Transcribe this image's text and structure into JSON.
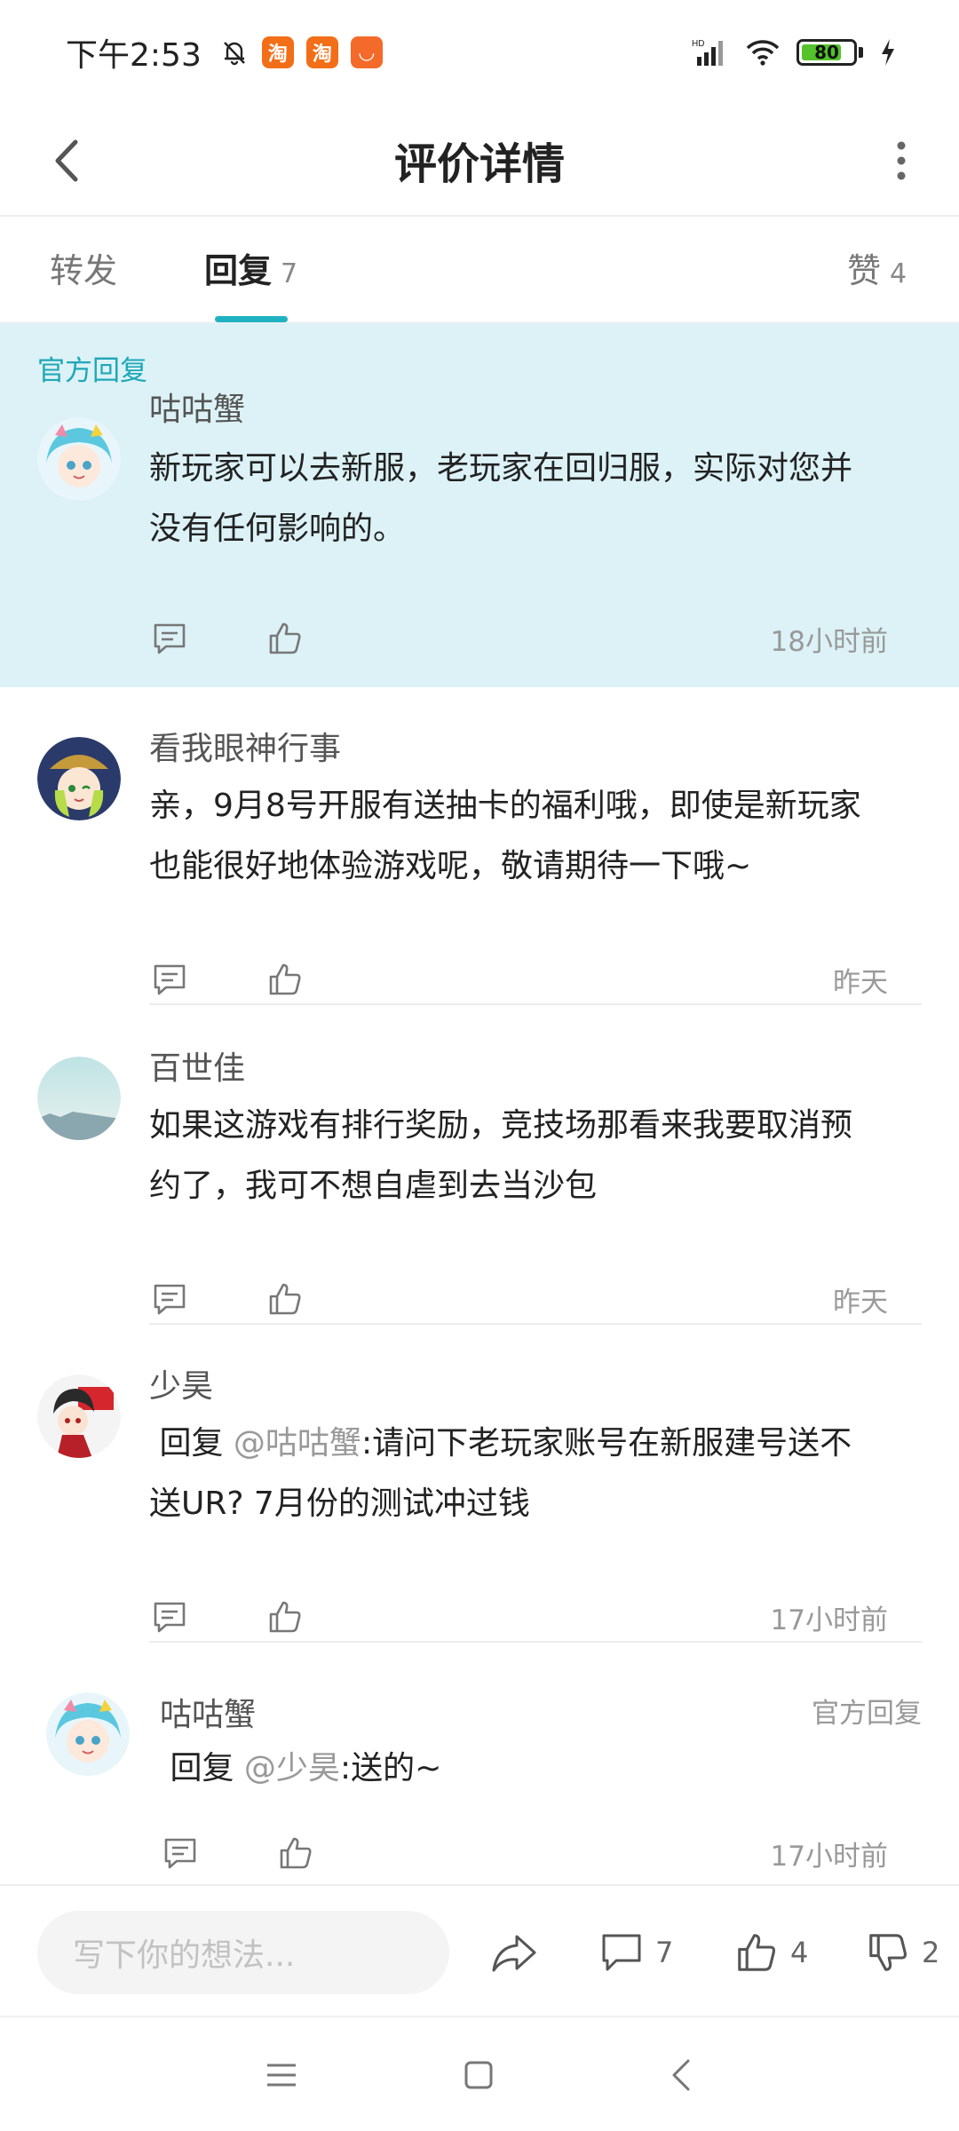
{
  "status_bar": {
    "time": "下午2:53",
    "app_badges": [
      "淘",
      "淘",
      "◡"
    ],
    "network": "HD",
    "battery_level": 80,
    "battery_text": "80"
  },
  "header": {
    "title": "评价详情"
  },
  "tabs": [
    {
      "label": "转发",
      "count": ""
    },
    {
      "label": "回复",
      "count": "7"
    },
    {
      "label": "赞",
      "count": "4"
    }
  ],
  "official_section_label": "官方回复",
  "comments": [
    {
      "name": "咕咕蟹",
      "lines": [
        "新玩家可以去新服，老玩家在回归服，实际对您并",
        "没有任何影响的。"
      ],
      "time": "18小时前"
    },
    {
      "name": "看我眼神行事",
      "lines": [
        "亲，9月8号开服有送抽卡的福利哦，即使是新玩家",
        "也能很好地体验游戏呢，敬请期待一下哦~"
      ],
      "time": "昨天"
    },
    {
      "name": "百世佳",
      "lines": [
        "如果这游戏有排行奖励，竞技场那看来我要取消预",
        "约了，我可不想自虐到去当沙包"
      ],
      "time": "昨天"
    },
    {
      "name": "少昊",
      "reply_word": "回复",
      "mention": "@咕咕蟹",
      "line1_rest": ":请问下老玩家账号在新服建号送不",
      "line2": "送UR? 7月份的测试冲过钱",
      "time": "17小时前"
    },
    {
      "name": "咕咕蟹",
      "tag": "官方回复",
      "reply_word": "回复",
      "mention": "@少昊",
      "line1_rest": ":送的~",
      "time": "17小时前"
    }
  ],
  "bottom_bar": {
    "input_placeholder": "写下你的想法...",
    "comment_count": "7",
    "like_count": "4",
    "dislike_count": "2"
  }
}
